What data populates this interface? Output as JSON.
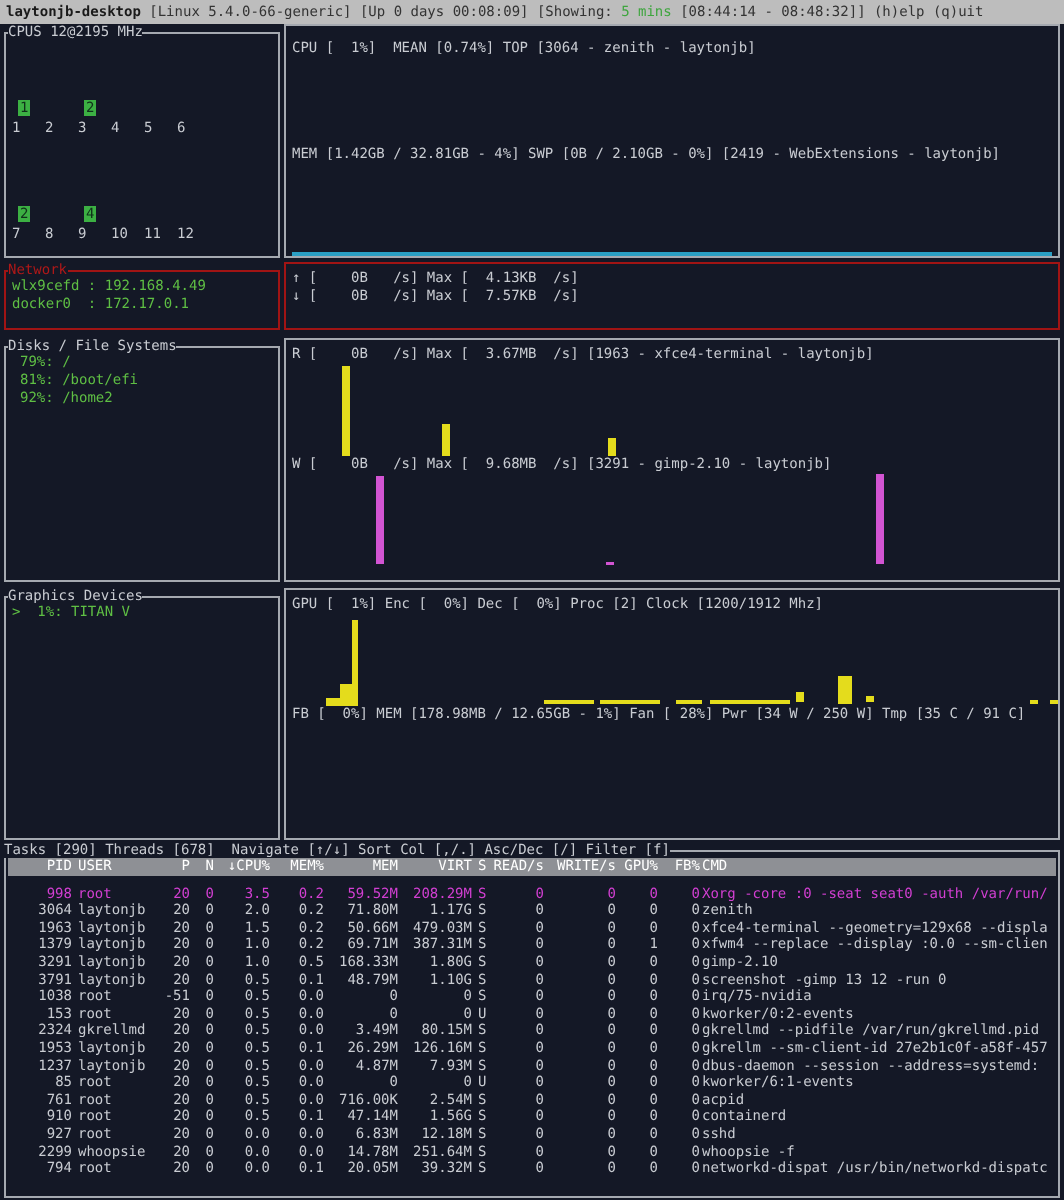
{
  "header": {
    "host": "laytonjb-desktop",
    "kernel": "[Linux 5.4.0-66-generic]",
    "uptime": "[Up 0 days 00:08:09]",
    "showing_label": "[Showing:",
    "showing_value": "5 mins",
    "time_range": "[08:44:14 - 08:48:32]]",
    "help": "(h)elp",
    "quit": "(q)uit"
  },
  "cpu": {
    "title": "CPUS 12@2195 MHz",
    "cores": [
      {
        "label": "1",
        "value": "1"
      },
      {
        "label": "2"
      },
      {
        "label": "3",
        "value": "2"
      },
      {
        "label": "4"
      },
      {
        "label": "5"
      },
      {
        "label": "6"
      },
      {
        "label": "7",
        "value": "2"
      },
      {
        "label": "8"
      },
      {
        "label": "9",
        "value": "4"
      },
      {
        "label": "10"
      },
      {
        "label": "11"
      },
      {
        "label": "12"
      }
    ],
    "cpu_line": "CPU [  1%]  MEAN [0.74%] TOP [3064 - zenith - laytonjb]",
    "mem_line": "MEM [1.42GB / 32.81GB - 4%] SWP [0B / 2.10GB - 0%] [2419 - WebExtensions - laytonjb]"
  },
  "network": {
    "title": "Network",
    "interfaces": [
      "wlx9cefd : 192.168.4.49",
      "docker0  : 172.17.0.1"
    ],
    "lines": [
      "↑ [    0B   /s] Max [  4.13KB  /s]",
      "↓ [    0B   /s] Max [  7.57KB  /s]"
    ]
  },
  "disks": {
    "title": "Disks / File Systems",
    "filesystems": [
      "79%: /",
      "81%: /boot/efi",
      "92%: /home2"
    ],
    "read_line": "R [    0B   /s] Max [  3.67MB  /s] [1963 - xfce4-terminal - laytonjb]",
    "write_line": "W [    0B   /s] Max [  9.68MB  /s] [3291 - gimp-2.10 - laytonjb]"
  },
  "graphics": {
    "title": "Graphics Devices",
    "devices": [
      ">  1%: TITAN V"
    ],
    "gpu_line": "GPU [  1%] Enc [  0%] Dec [  0%] Proc [2] Clock [1200/1912 Mhz]",
    "fb_line": "FB [  0%] MEM [178.98MB / 12.65GB - 1%] Fan [ 28%] Pwr [34 W / 250 W] Tmp [35 C / 91 C]"
  },
  "tasks": {
    "title": "Tasks [290] Threads [678]  Navigate [↑/↓] Sort Col [,/.] Asc/Dec [/] Filter [f]",
    "columns": [
      "PID",
      "USER",
      "P",
      "N",
      "↓CPU%",
      "MEM%",
      "MEM",
      "VIRT",
      "S",
      "READ/s",
      "WRITE/s",
      "GPU%",
      "FB%",
      "CMD"
    ],
    "rows": [
      {
        "cells": [
          "998",
          "root",
          "20",
          "0",
          "3.5",
          "0.2",
          "59.52M",
          "208.29M",
          "S",
          "0",
          "0",
          "0",
          "0",
          "Xorg -core :0 -seat seat0 -auth /var/run/"
        ],
        "selected": true
      },
      {
        "cells": [
          "3064",
          "laytonjb",
          "20",
          "0",
          "2.0",
          "0.2",
          "71.80M",
          "1.17G",
          "S",
          "0",
          "0",
          "0",
          "0",
          "zenith"
        ],
        "selected": false
      },
      {
        "cells": [
          "1963",
          "laytonjb",
          "20",
          "0",
          "1.5",
          "0.2",
          "50.66M",
          "479.03M",
          "S",
          "0",
          "0",
          "0",
          "0",
          "xfce4-terminal --geometry=129x68 --displa"
        ],
        "selected": false
      },
      {
        "cells": [
          "1379",
          "laytonjb",
          "20",
          "0",
          "1.0",
          "0.2",
          "69.71M",
          "387.31M",
          "S",
          "0",
          "0",
          "1",
          "0",
          "xfwm4 --replace --display :0.0 --sm-clien"
        ],
        "selected": false
      },
      {
        "cells": [
          "3291",
          "laytonjb",
          "20",
          "0",
          "1.0",
          "0.5",
          "168.33M",
          "1.80G",
          "S",
          "0",
          "0",
          "0",
          "0",
          "gimp-2.10"
        ],
        "selected": false
      },
      {
        "cells": [
          "3791",
          "laytonjb",
          "20",
          "0",
          "0.5",
          "0.1",
          "48.79M",
          "1.10G",
          "S",
          "0",
          "0",
          "0",
          "0",
          "screenshot -gimp 13 12 -run 0"
        ],
        "selected": false
      },
      {
        "cells": [
          "1038",
          "root",
          "-51",
          "0",
          "0.5",
          "0.0",
          "0",
          "0",
          "S",
          "0",
          "0",
          "0",
          "0",
          "irq/75-nvidia"
        ],
        "selected": false
      },
      {
        "cells": [
          "153",
          "root",
          "20",
          "0",
          "0.5",
          "0.0",
          "0",
          "0",
          "U",
          "0",
          "0",
          "0",
          "0",
          "kworker/0:2-events"
        ],
        "selected": false
      },
      {
        "cells": [
          "2324",
          "gkrellmd",
          "20",
          "0",
          "0.5",
          "0.0",
          "3.49M",
          "80.15M",
          "S",
          "0",
          "0",
          "0",
          "0",
          "gkrellmd --pidfile /var/run/gkrellmd.pid"
        ],
        "selected": false
      },
      {
        "cells": [
          "1953",
          "laytonjb",
          "20",
          "0",
          "0.5",
          "0.1",
          "26.29M",
          "126.16M",
          "S",
          "0",
          "0",
          "0",
          "0",
          "gkrellm --sm-client-id 27e2b1c0f-a58f-457"
        ],
        "selected": false
      },
      {
        "cells": [
          "1237",
          "laytonjb",
          "20",
          "0",
          "0.5",
          "0.0",
          "4.87M",
          "7.93M",
          "S",
          "0",
          "0",
          "0",
          "0",
          "dbus-daemon --session --address=systemd:"
        ],
        "selected": false
      },
      {
        "cells": [
          "85",
          "root",
          "20",
          "0",
          "0.5",
          "0.0",
          "0",
          "0",
          "U",
          "0",
          "0",
          "0",
          "0",
          "kworker/6:1-events"
        ],
        "selected": false
      },
      {
        "cells": [
          "761",
          "root",
          "20",
          "0",
          "0.5",
          "0.0",
          "716.00K",
          "2.54M",
          "S",
          "0",
          "0",
          "0",
          "0",
          "acpid"
        ],
        "selected": false
      },
      {
        "cells": [
          "910",
          "root",
          "20",
          "0",
          "0.5",
          "0.1",
          "47.14M",
          "1.56G",
          "S",
          "0",
          "0",
          "0",
          "0",
          "containerd"
        ],
        "selected": false
      },
      {
        "cells": [
          "927",
          "root",
          "20",
          "0",
          "0.0",
          "0.0",
          "6.83M",
          "12.18M",
          "S",
          "0",
          "0",
          "0",
          "0",
          "sshd"
        ],
        "selected": false
      },
      {
        "cells": [
          "2299",
          "whoopsie",
          "20",
          "0",
          "0.0",
          "0.0",
          "14.78M",
          "251.64M",
          "S",
          "0",
          "0",
          "0",
          "0",
          "whoopsie -f"
        ],
        "selected": false
      },
      {
        "cells": [
          "794",
          "root",
          "20",
          "0",
          "0.0",
          "0.1",
          "20.05M",
          "39.32M",
          "S",
          "0",
          "0",
          "0",
          "0",
          "networkd-dispat /usr/bin/networkd-dispatc"
        ],
        "selected": false
      }
    ]
  }
}
